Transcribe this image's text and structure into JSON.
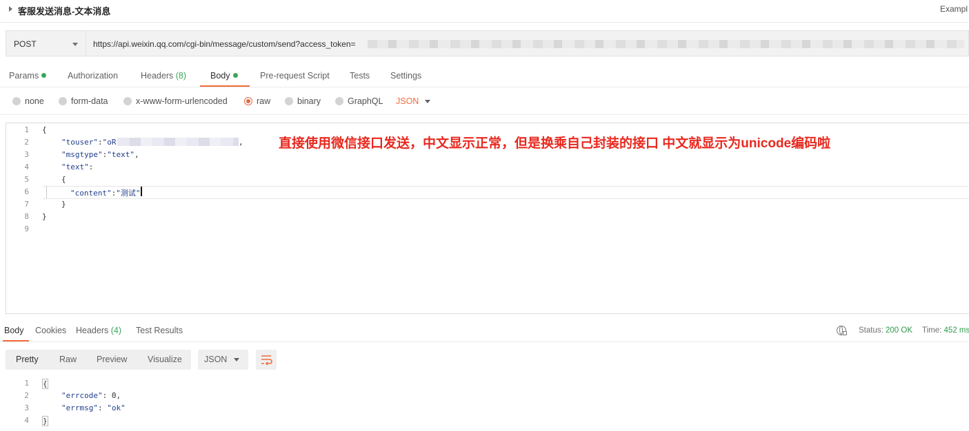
{
  "request": {
    "title": "客服发送消息-文本消息",
    "examples_label": "Exampl"
  },
  "url_bar": {
    "method": "POST",
    "url": "https://api.weixin.qq.com/cgi-bin/message/custom/send?access_token="
  },
  "request_tabs": {
    "params": "Params",
    "authorization": "Authorization",
    "headers": "Headers",
    "headers_count": "(8)",
    "body": "Body",
    "prerequest": "Pre-request Script",
    "tests": "Tests",
    "settings": "Settings",
    "active": "Body"
  },
  "body_modes": {
    "none": "none",
    "form_data": "form-data",
    "urlencoded": "x-www-form-urlencoded",
    "raw": "raw",
    "binary": "binary",
    "graphql": "GraphQL",
    "selected": "raw",
    "language": "JSON"
  },
  "request_editor": {
    "line_numbers": [
      "1",
      "2",
      "3",
      "4",
      "5",
      "6",
      "7",
      "8",
      "9"
    ],
    "touser_key": "\"touser\"",
    "touser_value_prefix": "\"oR",
    "touser_suffix": ",",
    "msgtype_key": "\"msgtype\"",
    "msgtype_value": "\"text\"",
    "text_key": "\"text\"",
    "content_key": "\"content\"",
    "content_value": "\"测试\""
  },
  "annotation": "直接使用微信接口发送，中文显示正常，但是换乘自己封装的接口 中文就显示为unicode编码啦",
  "response_tabs": {
    "body": "Body",
    "cookies": "Cookies",
    "headers": "Headers",
    "headers_count": "(4)",
    "test_results": "Test Results",
    "active": "Body"
  },
  "response_meta": {
    "status_label": "Status:",
    "status_value": "200 OK",
    "time_label": "Time:",
    "time_value": "452 ms"
  },
  "response_view": {
    "pretty": "Pretty",
    "raw": "Raw",
    "preview": "Preview",
    "visualize": "Visualize",
    "active": "Pretty",
    "format": "JSON"
  },
  "response_editor": {
    "line_numbers": [
      "1",
      "2",
      "3",
      "4"
    ],
    "errcode_key": "\"errcode\"",
    "errcode_value": "0",
    "errmsg_key": "\"errmsg\"",
    "errmsg_value": "\"ok\""
  },
  "colors": {
    "accent": "#f26b3a",
    "success": "#3ba55c",
    "annotation": "#e8281e",
    "string": "#1f3f8a"
  }
}
